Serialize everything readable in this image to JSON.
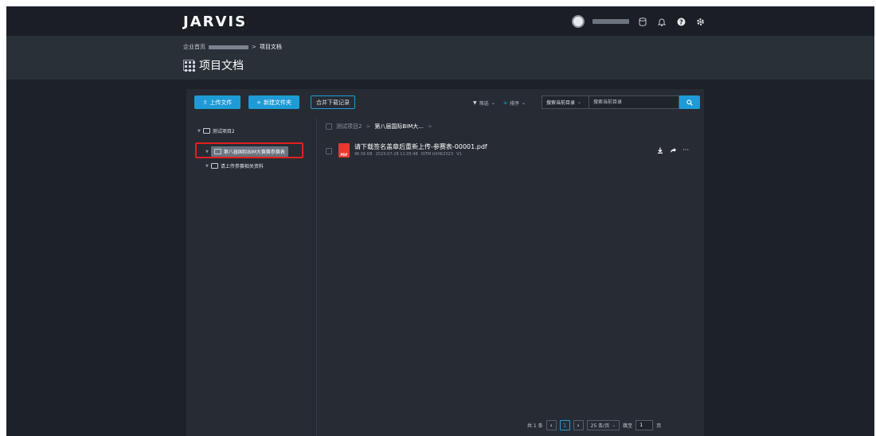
{
  "app": {
    "logo": "JARVIS"
  },
  "breadcrumb": {
    "home": "企业首页",
    "sep": ">",
    "current": "项目文档"
  },
  "page_title": "项目文档",
  "toolbar": {
    "upload": "上传文件",
    "new_folder": "新建文件夹",
    "merge_download": "合并下载记录",
    "filter": "筛选",
    "sort": "排序",
    "search_scope": "搜索当前目录",
    "search_placeholder": "搜索当前目录"
  },
  "tree": {
    "root": "测试项目2",
    "items": [
      {
        "label": "第八届国际BIM大赛赛参赛表"
      },
      {
        "label": "请上传参赛相关资料"
      }
    ]
  },
  "path": {
    "parent": "测试项目2",
    "current": "第八届国际BIM大...",
    "sep": ">"
  },
  "files": [
    {
      "name": "请下载签名盖章后重新上传-参赛表-00001.pdf",
      "size": "96.56 KB",
      "date": "2023-07-28 11:05:48",
      "owner": "IDTM b5HK2023",
      "version": "V1",
      "type_badge": "PDF"
    }
  ],
  "pager": {
    "total": "共 1 条",
    "current_page": "1",
    "page_size": "25 条/页",
    "goto_label": "跳至",
    "goto_value": "1",
    "page_unit": "页"
  },
  "colors": {
    "accent": "#1e9bd7",
    "highlight": "#e02020",
    "pdf": "#e8392f"
  }
}
